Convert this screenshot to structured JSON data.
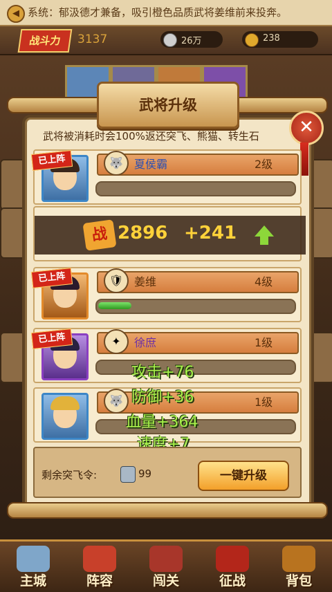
{
  "system_message": {
    "text": "系统：郁汲德才兼备，吸引橙色品质武将姜维前来投奔。"
  },
  "top_bar": {
    "power_label": "战斗力",
    "power_value": "3137",
    "silver": "26万",
    "gold": "238"
  },
  "dialog": {
    "title": "武将升级",
    "notice": "武将被消耗时会100%返还突飞、熊猫、转生石",
    "heroes": [
      {
        "badge": "已上阵",
        "name": "夏侯霸",
        "name_color": "#2a4fb3",
        "level": "2级",
        "xp_fraction": 0.0,
        "type_icon": "wolf-icon"
      },
      {
        "badge": "已上阵",
        "name": "姜维",
        "name_color": "#5a2f0a",
        "level": "4级",
        "xp_fraction": 0.17,
        "type_icon": "knight-icon"
      },
      {
        "badge": "已上阵",
        "name": "徐庶",
        "name_color": "#6a2ea8",
        "level": "1级",
        "xp_fraction": 0.0,
        "type_icon": "feather-icon"
      },
      {
        "badge": "",
        "name": "",
        "name_color": "#6a2ea8",
        "level": "1级",
        "xp_fraction": 0.0,
        "type_icon": "wolf-icon"
      }
    ],
    "power_popup": {
      "icon_text": "战",
      "value": "2896",
      "delta": "+241"
    },
    "float_stats": [
      "攻击+76",
      "防御+36",
      "血量+364",
      "速度+7"
    ],
    "remaining_label": "剩余突飞令:",
    "remaining_count": "99",
    "upgrade_button": "一键升级"
  },
  "nav": [
    "主城",
    "阵容",
    "闯关",
    "征战",
    "背包"
  ]
}
